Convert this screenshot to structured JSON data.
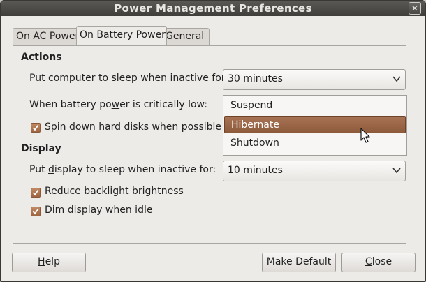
{
  "window": {
    "title": "Power Management Preferences",
    "close_glyph": "✕"
  },
  "tabs": [
    {
      "label": "On AC Power",
      "active": false
    },
    {
      "label": "On Battery Power",
      "active": true
    },
    {
      "label": "General",
      "active": false
    }
  ],
  "actions": {
    "title": "Actions",
    "sleep_label_pre": "Put computer to ",
    "sleep_label_ul": "s",
    "sleep_label_post": "leep when inactive for:",
    "sleep_value": "30 minutes",
    "critical_label_pre": "When battery po",
    "critical_label_ul": "w",
    "critical_label_post": "er is critically low:",
    "critical_options": [
      "Suspend",
      "Hibernate",
      "Shutdown"
    ],
    "critical_selected": "Hibernate",
    "spin_label_pre": "Sp",
    "spin_label_ul": "i",
    "spin_label_post": "n down hard disks when possible",
    "spin_checked": true
  },
  "display": {
    "title": "Display",
    "sleep_label_pre": "Put ",
    "sleep_label_ul": "d",
    "sleep_label_post": "isplay to sleep when inactive for:",
    "sleep_value": "10 minutes",
    "backlight_label_pre": "",
    "backlight_label_ul": "R",
    "backlight_label_post": "educe backlight brightness",
    "backlight_checked": true,
    "dim_label_pre": "Di",
    "dim_label_ul": "m",
    "dim_label_post": " display when idle",
    "dim_checked": true
  },
  "buttons": {
    "help_ul": "H",
    "help_rest": "elp",
    "make_default": "Make Default",
    "close_ul": "C",
    "close_rest": "lose"
  },
  "colors": {
    "accent": "#9b6545",
    "titlebar": "#4a4844",
    "window_bg": "#edebe8"
  },
  "icons": {
    "chevron": "chevron-down-icon",
    "check": "checkmark-icon",
    "cursor": "mouse-pointer-icon"
  }
}
